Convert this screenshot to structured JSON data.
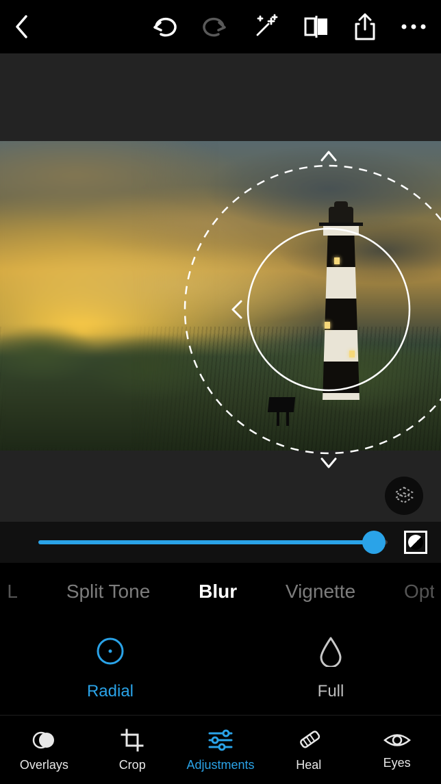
{
  "colors": {
    "accent": "#2aa3e8"
  },
  "slider": {
    "value": 96
  },
  "adjust_tabs": {
    "edge_left": "L",
    "split_tone": "Split Tone",
    "blur": "Blur",
    "vignette": "Vignette",
    "edge_right": "Opt"
  },
  "blur_modes": {
    "radial": "Radial",
    "full": "Full"
  },
  "bottom_nav": {
    "overlays": "Overlays",
    "crop": "Crop",
    "adjustments": "Adjustments",
    "heal": "Heal",
    "eyes": "Eyes"
  }
}
